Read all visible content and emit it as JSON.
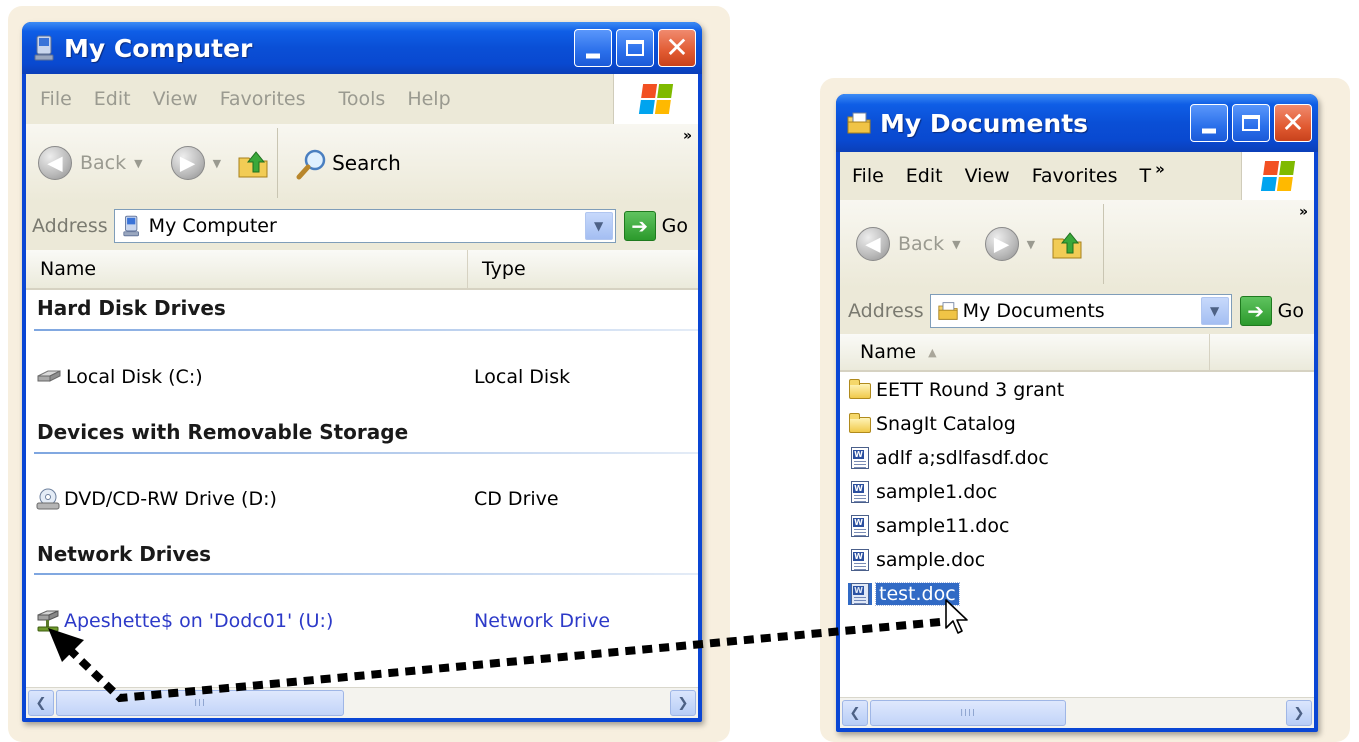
{
  "my_computer": {
    "title": "My Computer",
    "menu": [
      "File",
      "Edit",
      "View",
      "Favorites",
      "Tools",
      "Help"
    ],
    "toolbar": {
      "back_label": "Back",
      "search_label": "Search",
      "overflow": "»"
    },
    "address": {
      "label": "Address",
      "value": "My Computer",
      "go_label": "Go"
    },
    "columns": [
      "Name",
      "Type"
    ],
    "groups": [
      {
        "label": "Hard Disk Drives",
        "items": [
          {
            "name": "Local Disk (C:)",
            "type": "Local Disk",
            "icon": "hard-disk-icon"
          }
        ]
      },
      {
        "label": "Devices with Removable Storage",
        "items": [
          {
            "name": "DVD/CD-RW Drive (D:)",
            "type": "CD Drive",
            "icon": "cd-drive-icon"
          }
        ]
      },
      {
        "label": "Network Drives",
        "items": [
          {
            "name": "Apeshette$ on 'Dodc01' (U:)",
            "type": "Network Drive",
            "icon": "network-drive-icon"
          }
        ]
      }
    ],
    "scroll_thumb": "III"
  },
  "my_documents": {
    "title": "My Documents",
    "menu": [
      "File",
      "Edit",
      "View",
      "Favorites",
      "T"
    ],
    "menu_overflow": "»",
    "toolbar": {
      "back_label": "Back",
      "overflow": "»"
    },
    "address": {
      "label": "Address",
      "value": "My Documents",
      "go_label": "Go"
    },
    "column_name": "Name",
    "sort_indicator": "▲",
    "files": [
      {
        "name": "EETT Round 3 grant",
        "icon": "folder-icon"
      },
      {
        "name": "SnagIt Catalog",
        "icon": "folder-icon"
      },
      {
        "name": "adlf a;sdlfasdf.doc",
        "icon": "word-doc-icon"
      },
      {
        "name": "sample1.doc",
        "icon": "word-doc-icon"
      },
      {
        "name": "sample11.doc",
        "icon": "word-doc-icon"
      },
      {
        "name": "sample.doc",
        "icon": "word-doc-icon"
      },
      {
        "name": "test.doc",
        "icon": "word-doc-icon",
        "selected": true
      }
    ],
    "scroll_thumb": "IIII"
  },
  "colors": {
    "xp_blue": "#0a46d4",
    "selection": "#316ac5",
    "link": "#2d3ac8",
    "background_glow": "#f7efdf"
  }
}
